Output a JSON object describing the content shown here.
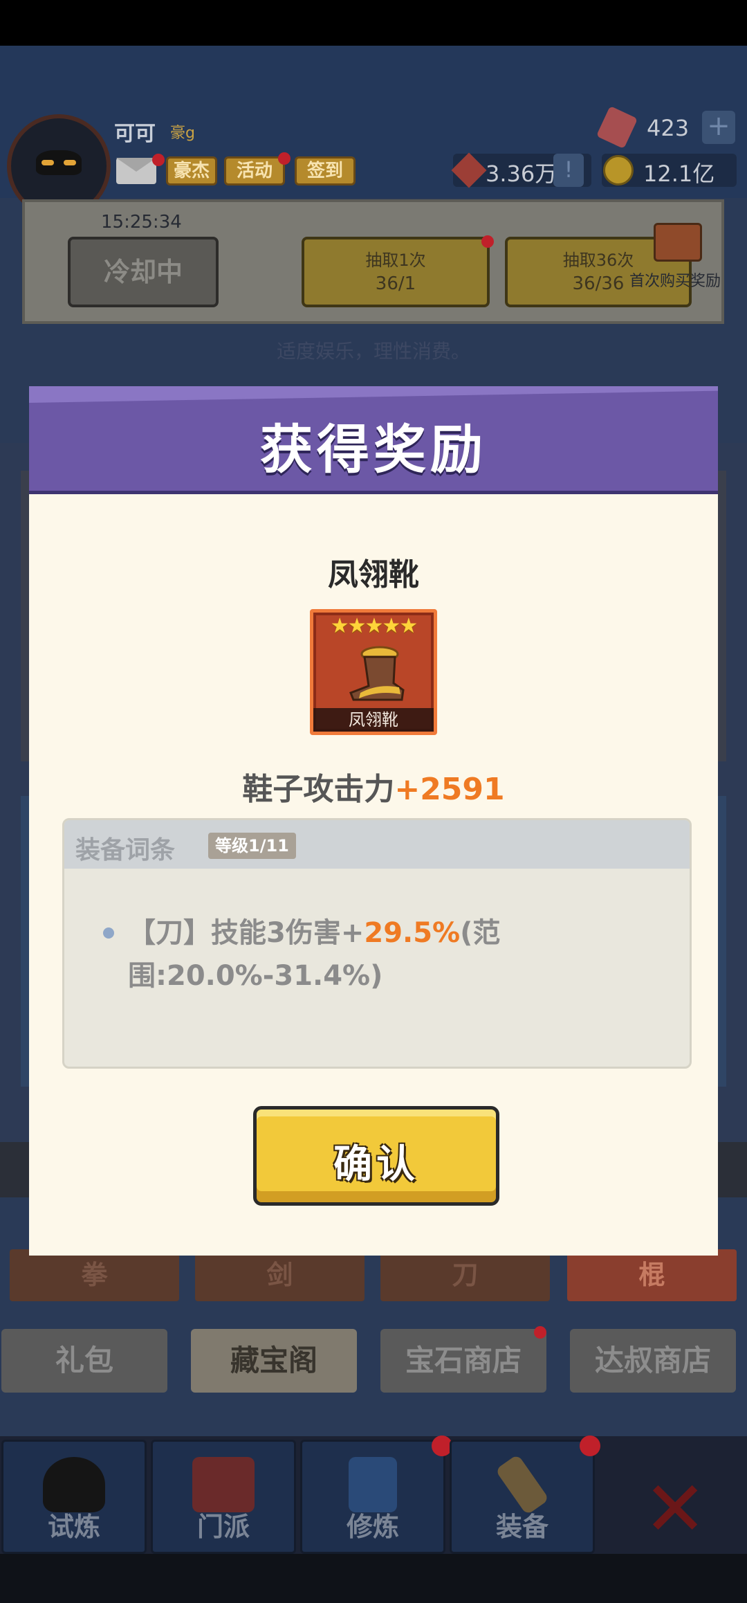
{
  "player": {
    "name": "可可",
    "rank": "豪g",
    "tag_hero": "豪杰",
    "tag_event": "活动",
    "tag_signin": "签到"
  },
  "resources": {
    "gems": "423",
    "power": "3.36万",
    "coins": "12.1亿"
  },
  "draw": {
    "timer": "15:25:34",
    "cooldown_label": "冷却中",
    "draw1_label": "抽取1次",
    "draw1_count": "36/1",
    "draw36_label": "抽取36次",
    "draw36_count": "36/36",
    "first_buy_label": "首次购买奖励",
    "notice": "适度娱乐，理性消费。"
  },
  "weapon_tabs": [
    "拳",
    "剑",
    "刀",
    "棍"
  ],
  "shop_tabs": [
    "礼包",
    "藏宝阁",
    "宝石商店",
    "达叔商店"
  ],
  "nav": [
    "试炼",
    "门派",
    "修炼",
    "装备"
  ],
  "modal": {
    "title": "获得奖励",
    "item_name": "凤翎靴",
    "item_stars": "★★★★★",
    "item_card_label": "凤翎靴",
    "attack_label": "鞋子攻击力",
    "attack_value": "+2591",
    "affix_title": "装备词条",
    "affix_level": "等级1/11",
    "affix_prefix": "【刀】技能3伤害+",
    "affix_pct": "29.5%",
    "affix_range": "(范围:20.0%-31.4%)",
    "confirm_label": "确认"
  },
  "colors": {
    "modal_header": "#6c58a6",
    "accent_orange": "#ef7a23",
    "confirm_yellow": "#f2c93a"
  }
}
